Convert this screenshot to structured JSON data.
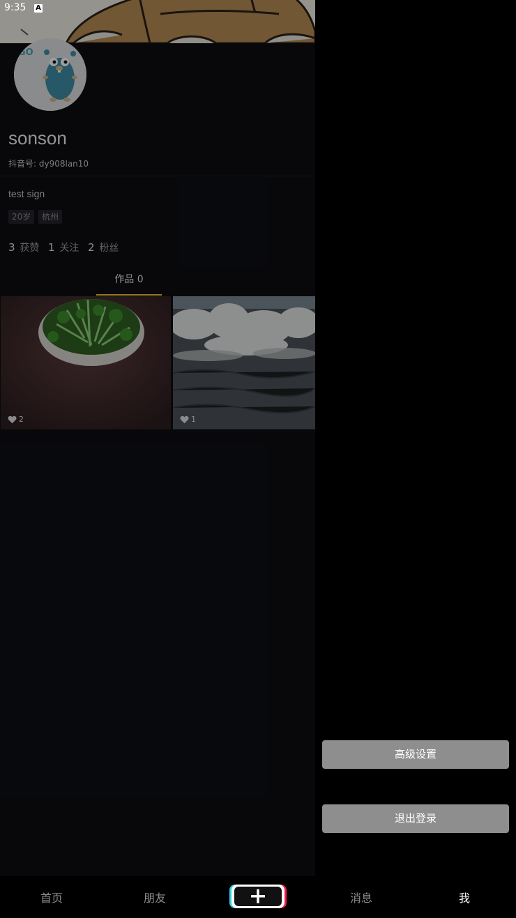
{
  "status": {
    "time": "9:35",
    "notification_icon": "A"
  },
  "profile": {
    "username": "sonson",
    "douyin_id": "抖音号: dy908lan10",
    "signature": "test sign",
    "tags": [
      "20岁",
      "杭州"
    ],
    "stats": [
      {
        "value": "3",
        "label": "获赞"
      },
      {
        "value": "1",
        "label": "关注"
      },
      {
        "value": "2",
        "label": "粉丝"
      }
    ],
    "tab_label": "作品 0"
  },
  "videos": [
    {
      "likes": "2",
      "icon": "heart-icon"
    },
    {
      "likes": "1",
      "icon": "heart-icon"
    }
  ],
  "drawer": {
    "advanced_settings": "高级设置",
    "logout": "退出登录"
  },
  "nav": {
    "home": "首页",
    "friends": "朋友",
    "messages": "消息",
    "me": "我",
    "add_icon": "plus-icon"
  },
  "colors": {
    "tab_underline": "#f5c12e",
    "drawer_button": "#8e8e8e",
    "plus_cyan": "#35d0e6",
    "plus_pink": "#ee1d52"
  }
}
